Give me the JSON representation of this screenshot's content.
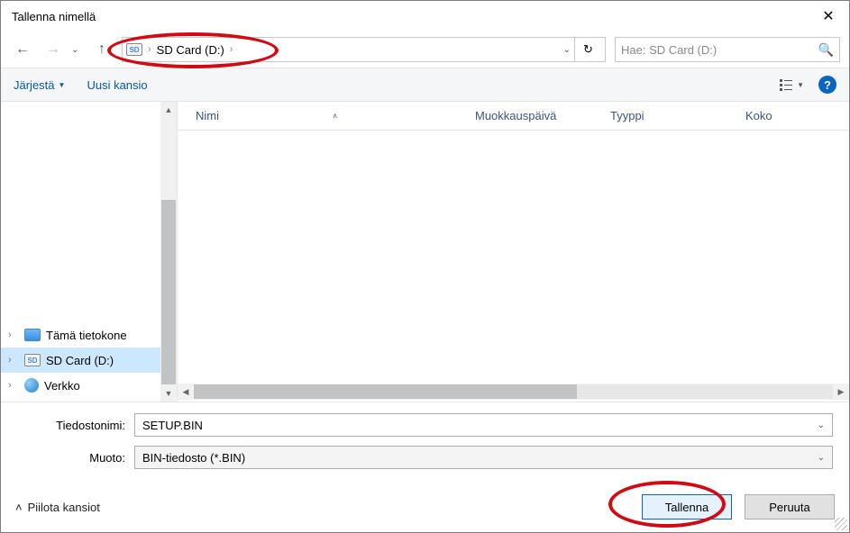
{
  "title": "Tallenna nimellä",
  "nav": {
    "breadcrumb_root_icon": "sd-icon",
    "breadcrumb": "SD Card (D:)",
    "refresh_icon": "refresh-icon",
    "search_placeholder": "Hae: SD Card (D:)"
  },
  "toolbar": {
    "organize": "Järjestä",
    "new_folder": "Uusi kansio"
  },
  "columns": {
    "name": "Nimi",
    "modified": "Muokkauspäivä",
    "type": "Tyyppi",
    "size": "Koko"
  },
  "sidebar": {
    "items": [
      {
        "label": "Tämä tietokone",
        "icon": "pc-icon"
      },
      {
        "label": "SD Card (D:)",
        "icon": "sd-icon",
        "selected": true
      },
      {
        "label": "Verkko",
        "icon": "net-icon"
      }
    ]
  },
  "form": {
    "filename_label": "Tiedostonimi:",
    "filename_value": "SETUP.BIN",
    "format_label": "Muoto:",
    "format_value": "BIN-tiedosto (*.BIN)"
  },
  "footer": {
    "hide_folders": "Piilota kansiot",
    "save": "Tallenna",
    "cancel": "Peruuta"
  }
}
